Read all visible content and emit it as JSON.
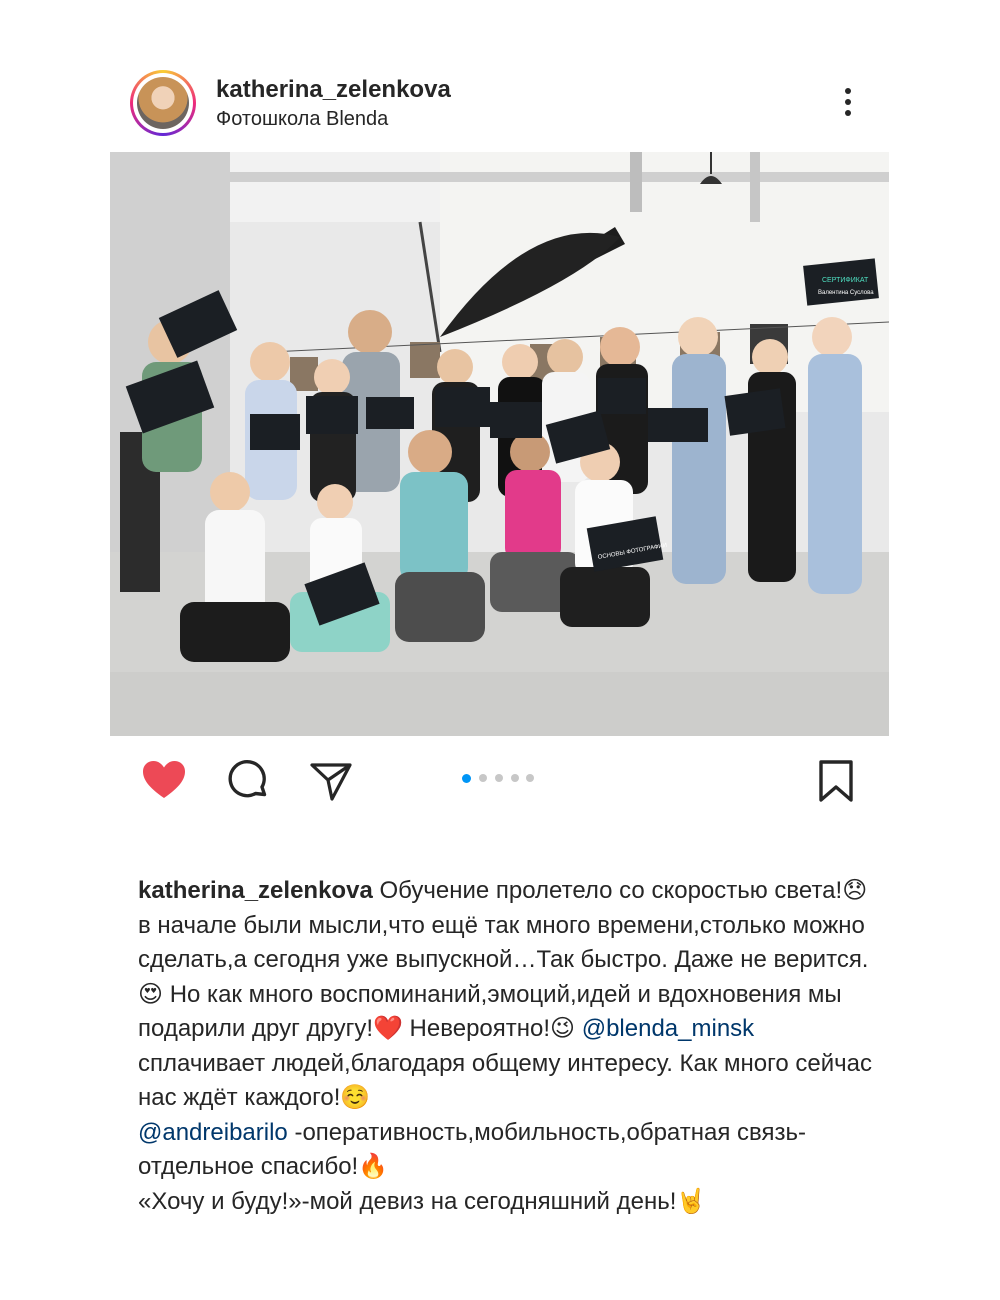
{
  "post": {
    "username": "katherina_zelenkova",
    "location": "Фотошкола Blenda",
    "carousel": {
      "total": 5,
      "current": 1
    },
    "liked": true
  },
  "photo_text": {
    "cert_title": "СЕРТИФИКАТ",
    "cert_name": "Валентина Суслова",
    "cert_course": "ОСНОВЫ ФОТОГРАФИИ"
  },
  "caption": {
    "username": "katherina_zelenkova",
    "part1": " Обучение пролетело со скоростью света!😞 в начале были мысли,что ещё так много времени,столько можно сделать,а сегодня уже выпускной…Так быстро. Даже не верится. 😍 Но как много воспоминаний,эмоций,идей и вдохновения мы подарили друг другу!❤️ Невероятно!😉 ",
    "mention1": "@blenda_minsk",
    "part2": " сплачивает людей,благодаря общему интересу. Как много сейчас нас ждёт каждого!☺️\n",
    "mention2": "@andreibarilo",
    "part3": " -оперативность,мобильность,обратная связь-отдельное спасибо!🔥\n«Хочу и буду!»-мой девиз на сегодняшний день!🤘"
  },
  "icons": [
    "more-icon",
    "heart-icon",
    "comment-icon",
    "share-icon",
    "bookmark-icon"
  ],
  "colors": {
    "heart": "#ed4956",
    "mention": "#00376b",
    "dot_active": "#0095f6",
    "dot_inactive": "#c7c7c7"
  }
}
